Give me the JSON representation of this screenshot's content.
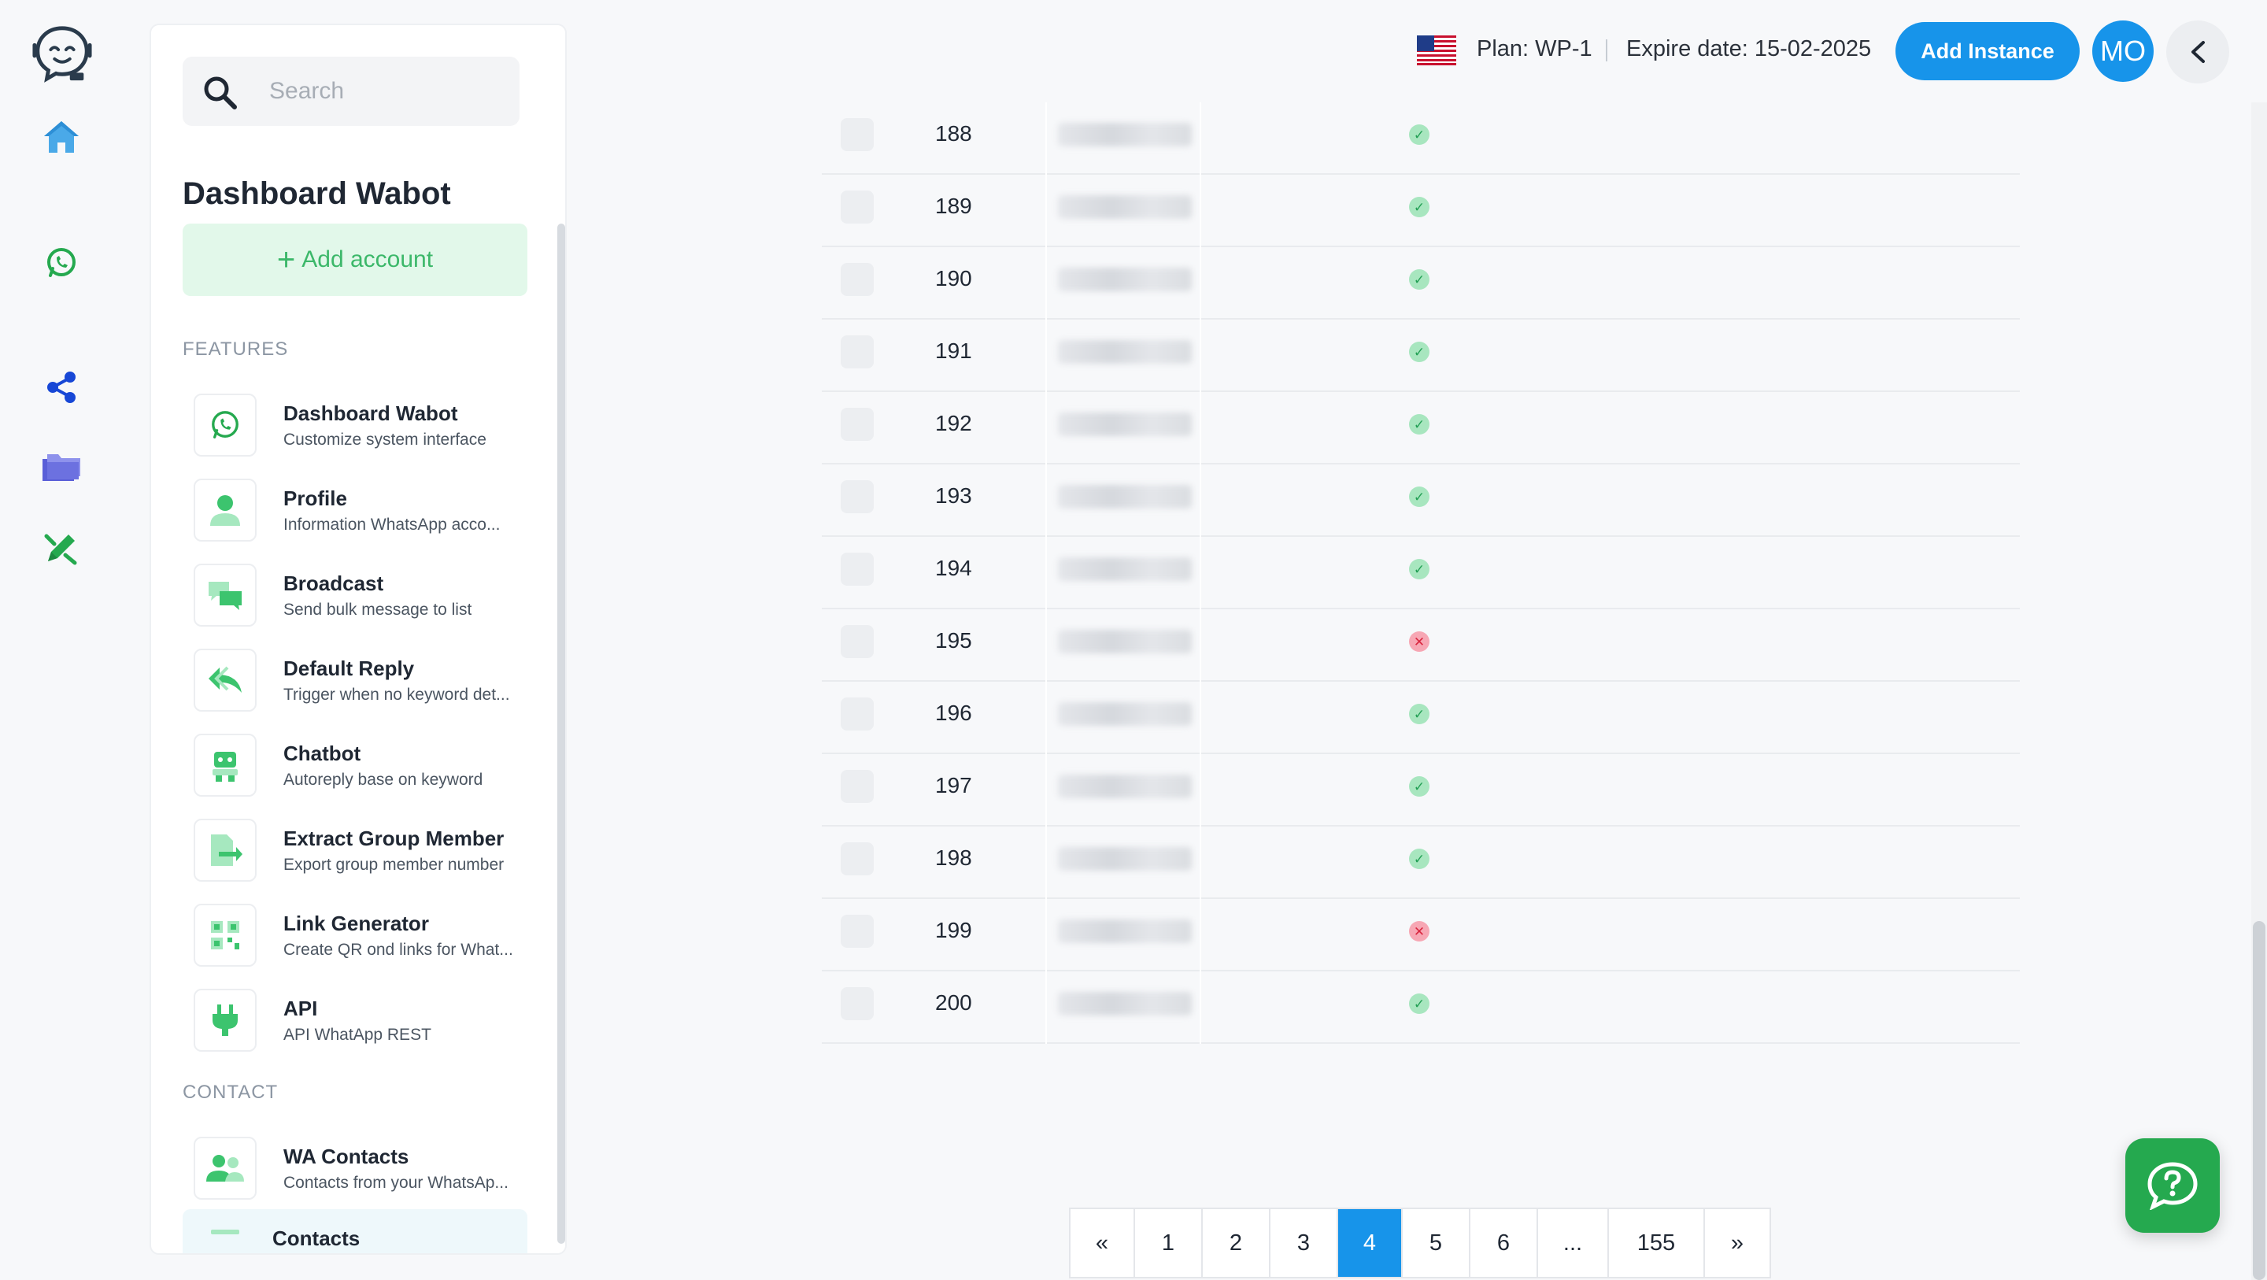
{
  "header": {
    "plan": "Plan: WP-1",
    "expire": "Expire date: 15-02-2025",
    "add_instance_label": "Add Instance",
    "avatar_initials": "MO"
  },
  "sidebar": {
    "search_placeholder": "Search",
    "title": "Dashboard Wabot",
    "add_account_label": "Add account",
    "features_label": "FEATURES",
    "features": [
      {
        "name": "Dashboard Wabot",
        "desc": "Customize system interface",
        "icon": "whatsapp-icon"
      },
      {
        "name": "Profile",
        "desc": "Information WhatsApp acco...",
        "icon": "user-icon"
      },
      {
        "name": "Broadcast",
        "desc": "Send bulk message to list",
        "icon": "chat-bubbles-icon"
      },
      {
        "name": "Default Reply",
        "desc": "Trigger when no keyword det...",
        "icon": "reply-icon"
      },
      {
        "name": "Chatbot",
        "desc": "Autoreply base on keyword",
        "icon": "robot-icon"
      },
      {
        "name": "Extract Group Member",
        "desc": "Export group member number",
        "icon": "export-file-icon"
      },
      {
        "name": "Link Generator",
        "desc": "Create QR ond links for What...",
        "icon": "qr-code-icon"
      },
      {
        "name": "API",
        "desc": "API WhatApp REST",
        "icon": "plug-icon"
      }
    ],
    "contact_label": "CONTACT",
    "contacts": [
      {
        "name": "WA Contacts",
        "desc": "Contacts from your WhatsAp...",
        "icon": "users-icon"
      },
      {
        "name": "Contacts",
        "desc": "",
        "icon": "contacts-icon"
      }
    ]
  },
  "rail": [
    "logo-icon",
    "home-icon",
    "whatsapp-icon",
    "share-nodes-icon",
    "folders-icon",
    "edit-icon"
  ],
  "table": {
    "rows": [
      {
        "num": "188",
        "status": "ok"
      },
      {
        "num": "189",
        "status": "ok"
      },
      {
        "num": "190",
        "status": "ok"
      },
      {
        "num": "191",
        "status": "ok"
      },
      {
        "num": "192",
        "status": "ok"
      },
      {
        "num": "193",
        "status": "ok"
      },
      {
        "num": "194",
        "status": "ok"
      },
      {
        "num": "195",
        "status": "fail"
      },
      {
        "num": "196",
        "status": "ok"
      },
      {
        "num": "197",
        "status": "ok"
      },
      {
        "num": "198",
        "status": "ok"
      },
      {
        "num": "199",
        "status": "fail"
      },
      {
        "num": "200",
        "status": "ok"
      }
    ]
  },
  "pagination": {
    "pages": [
      "«",
      "1",
      "2",
      "3",
      "4",
      "5",
      "6",
      "...",
      "155",
      "»"
    ],
    "active": "4"
  },
  "colors": {
    "accent": "#1794ea",
    "green": "#25a94f",
    "ok": "#23a055",
    "fail": "#d9263f"
  }
}
